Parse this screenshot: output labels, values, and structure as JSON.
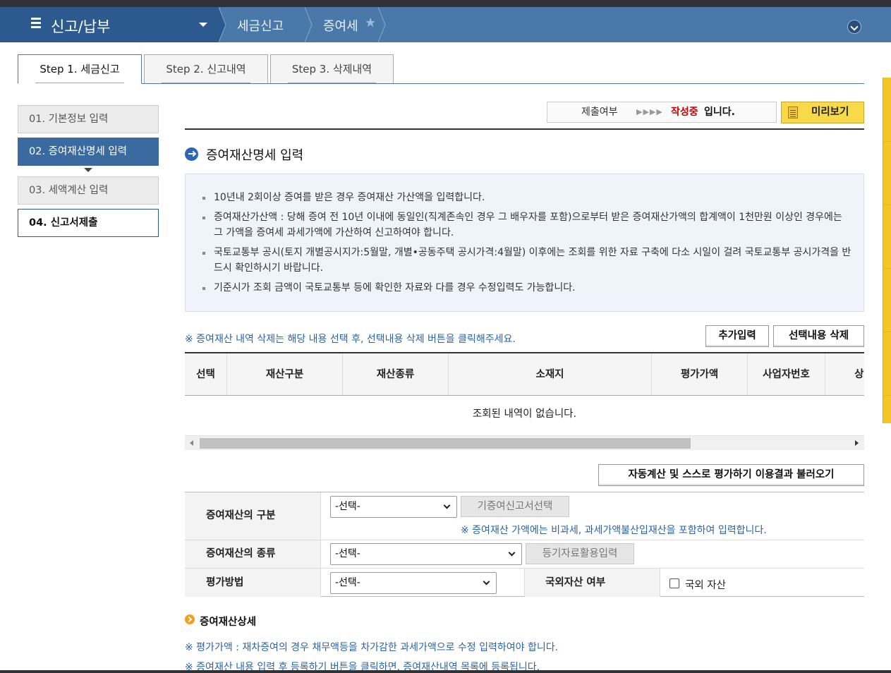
{
  "topnav": {
    "menu_title": "신고/납부",
    "crumbs": [
      "세금신고",
      "증여세"
    ]
  },
  "steps": [
    "Step 1. 세금신고",
    "Step 2. 신고내역",
    "Step 3. 삭제내역"
  ],
  "sidebar": {
    "items": [
      "01. 기본정보 입력",
      "02. 증여재산명세 입력",
      "03. 세액계산 입력",
      "04. 신고서제출"
    ]
  },
  "status": {
    "label": "제출여부",
    "arrows": "▶▶▶▶",
    "value": "작성중",
    "suffix": "입니다."
  },
  "preview_label": "미리보기",
  "section_title": "증여재산명세 입력",
  "notices": [
    "10년내 2회이상 증여를 받은 경우 증여재산 가산액을 입력합니다.",
    "증여재산가산액 : 당해 증여 전 10년 이내에 동일인(직계존속인 경우 그 배우자를 포함)으로부터 받은 증여재산가액의 합계액이 1천만원 이상인 경우에는 그 가액을 증여세 과세가액에 가산하여 신고하여야 합니다.",
    "국토교통부 공시(토지 개별공시지가:5월말, 개별•공동주택 공시가격:4월말) 이후에는 조회를 위한 자료 구축에 다소 시일이 걸려 국토교통부 공시가격을 반드시 확인하시기 바랍니다.",
    "기준시가 조회 금액이 국토교통부 등에 확인한 자료와 다를 경우 수정입력도 가능합니다."
  ],
  "delete_note": "※ 증여재산 내역 삭제는 해당 내용 선택 후, 선택내용 삭제 버튼을  클릭해주세요.",
  "buttons": {
    "add": "추가입력",
    "delete_selected": "선택내용 삭제",
    "load_auto": "자동계산 및 스스로 평가하기 이용결과 불러오기",
    "select_prior_return": "기증여신고서선택",
    "registry_input": "등기자료활용입력"
  },
  "table": {
    "columns": [
      "선택",
      "재산구분",
      "재산종류",
      "소재지",
      "평가가액",
      "사업자번호",
      "상호"
    ],
    "empty_message": "조회된 내역이 없습니다."
  },
  "form": {
    "category_label": "증여재산의 구분",
    "category_value": "-선택-",
    "category_tip": "※ 증여재산 가액에는 비과세, 과세가액불산입재산을 포함하여 입력합니다.",
    "type_label": "증여재산의 종류",
    "type_value": "-선택-",
    "method_label": "평가방법",
    "method_value": "-선택-",
    "overseas_label": "국외자산 여부",
    "overseas_checkbox": "국외 자산"
  },
  "detail_title": "증여재산상세",
  "detail_notes": [
    "※ 평가가액 : 재차증여의 경우 채무액등을 차가감한 과세가액으로 수정 입력하여야 합니다.",
    "※ 증여재산 내용 입력 후 등록하기 버튼을 클릭하면, 증여재산내역 목록에 등록됩니다."
  ],
  "colors": {
    "nav_dark": "#2d5a8e",
    "nav": "#4a78a8",
    "accent_blue": "#3a6aa0",
    "status_red": "#cc0000",
    "preview_yellow": "#f8d94a",
    "tip_blue": "#2a63a8"
  }
}
